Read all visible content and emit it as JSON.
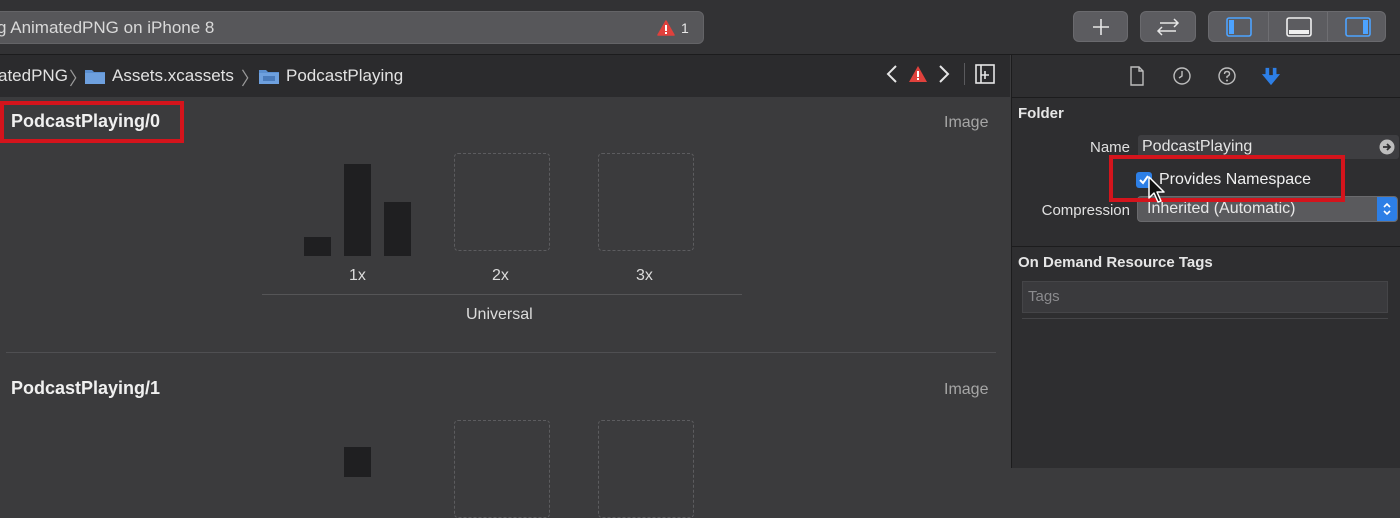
{
  "toolbar": {
    "activity_text": "g AnimatedPNG on iPhone 8",
    "warning_count": "1",
    "add_button_icon": "plus-icon",
    "back_forward_icon": "back-forward-arrows-icon",
    "panel_toggles": [
      "left-panel-icon",
      "bottom-panel-icon",
      "right-panel-icon"
    ]
  },
  "breadcrumb": {
    "items": [
      "atedPNG",
      "Assets.xcassets",
      "PodcastPlaying"
    ]
  },
  "editor": {
    "sets": [
      {
        "title": "PodcastPlaying/0",
        "kind": "Image",
        "scales": [
          "1x",
          "2x",
          "3x"
        ],
        "device_group": "Universal"
      },
      {
        "title": "PodcastPlaying/1",
        "kind": "Image"
      }
    ]
  },
  "inspector": {
    "section_folder": "Folder",
    "name_label": "Name",
    "name_value": "PodcastPlaying",
    "provides_namespace_label": "Provides Namespace",
    "provides_namespace_checked": true,
    "compression_label": "Compression",
    "compression_value": "Inherited (Automatic)",
    "section_odr": "On Demand Resource Tags",
    "tags_placeholder": "Tags"
  },
  "colors": {
    "accent": "#2d7fe6",
    "highlight": "#d4141c",
    "warning": "#e0413c"
  }
}
